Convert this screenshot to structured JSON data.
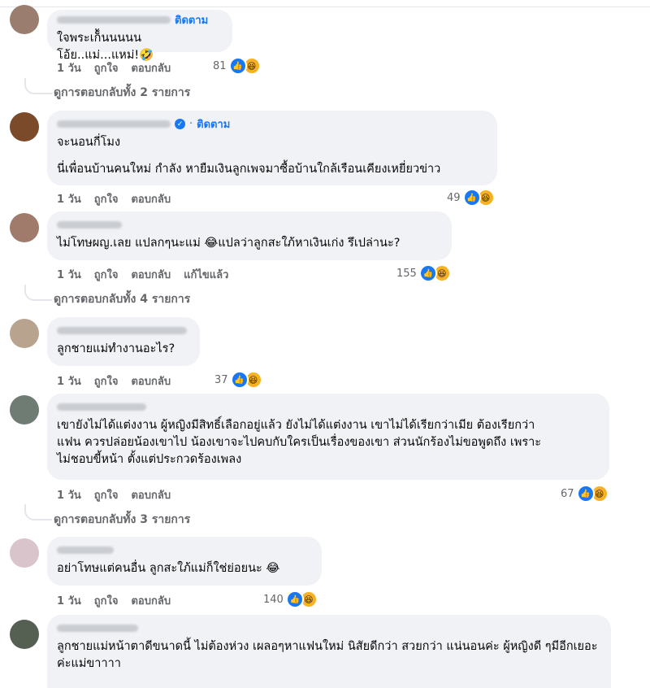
{
  "follow_label": "ติดตาม",
  "action_labels": {
    "time": "1 วัน",
    "like": "ถูกใจ",
    "reply": "ตอบกลับ",
    "edited": "แก้ไขแล้ว"
  },
  "icons": {
    "like": "thumbs-up-icon",
    "haha": "laughing-face-icon",
    "verified": "verified-check-icon"
  },
  "colors": {
    "accent": "#1877f2",
    "bubble": "#f0f2f5",
    "muted": "#65676b",
    "haha": "#f7b125"
  },
  "comments": [
    {
      "text": [
        "ใจพระเก็้นนนนน โอ้ย..แม่...แหม่!🤣"
      ],
      "reactions": "81",
      "replies": "ดูการตอบกลับทั้ง 2 รายการ"
    },
    {
      "text": [
        "จะนอนกี่โมง",
        "นี่เพื่อนบ้านคนใหม่ กำลัง หายืมเงินลูกเพจมาซื้อบ้านใกล้เรือนเคียงเหยี่ยวข่าว"
      ],
      "reactions": "49"
    },
    {
      "text": [
        "ไม่โทษผญ.เลย แปลกๆนะแม่ 😂แปลว่าลูกสะใภ้หาเงินเก่ง รึเปล่านะ?"
      ],
      "reactions": "155",
      "replies": "ดูการตอบกลับทั้ง 4 รายการ"
    },
    {
      "text": [
        "ลูกชายแม่ทำงานอะไร?"
      ],
      "reactions": "37"
    },
    {
      "text": [
        "เขายังไม่ได้แต่งงาน ผู้หญิงมีสิทธิ์เลือกอยู่แล้ว ยังไม่ได้แต่งงาน เขาไม่ได้เรียกว่าเมีย ต้องเรียกว่า แฟน ควรปล่อยน้องเขาไป น้องเขาจะไปคบกับใครเป็นเรื่องของเขา ส่วนนักร้องไม่ขอพูดถึง เพราะ ไม่ชอบขี้หน้า ตั้งแต่ประกวดร้องเพลง"
      ],
      "reactions": "67",
      "replies": "ดูการตอบกลับทั้ง 3 รายการ"
    },
    {
      "text": [
        "อย่าโทษแต่คนอื่น ลูกสะใภ้แม่ก็ใช่ย่อยนะ 😂"
      ],
      "reactions": "140"
    },
    {
      "text": [
        "ลูกชายแม่หน้าตาดีขนาดนี้ ไม่ต้องห่วง เผลอๆหาแฟนใหม่ นิสัยดีกว่า สวยกว่า แน่นอนค่ะ ผู้หญิงดี ๆมีอีกเยอะค่ะแม่ขาาาา"
      ]
    }
  ]
}
